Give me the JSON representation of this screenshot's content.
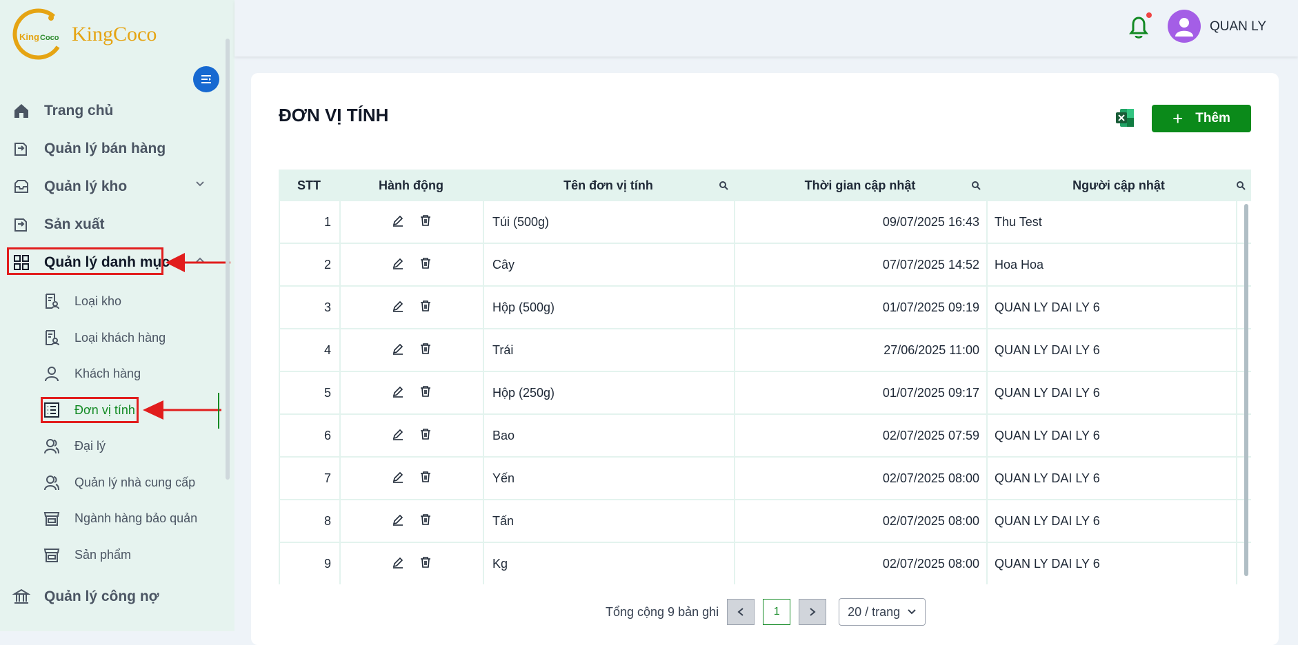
{
  "brand": {
    "name": "KingCoco",
    "logo_text": "KingCoco"
  },
  "header": {
    "username": "QUAN LY"
  },
  "sidebar": {
    "items": [
      {
        "label": "Trang chủ",
        "icon": "home-icon"
      },
      {
        "label": "Quản lý bán hàng",
        "icon": "sales-icon"
      },
      {
        "label": "Quản lý kho",
        "icon": "inventory-icon"
      },
      {
        "label": "Sản xuất",
        "icon": "production-icon"
      },
      {
        "label": "Quản lý danh mục",
        "icon": "grid-icon"
      },
      {
        "label": "Quản lý công nợ",
        "icon": "bank-icon"
      }
    ],
    "sub_items": [
      {
        "label": "Loại kho",
        "icon": "doc-user-icon"
      },
      {
        "label": "Loại khách hàng",
        "icon": "doc-user-icon"
      },
      {
        "label": "Khách hàng",
        "icon": "user-icon"
      },
      {
        "label": "Đơn vị tính",
        "icon": "list-icon"
      },
      {
        "label": "Đại lý",
        "icon": "users-icon"
      },
      {
        "label": "Quản lý nhà cung cấp",
        "icon": "users-icon"
      },
      {
        "label": "Ngành hàng bảo quản",
        "icon": "store-icon"
      },
      {
        "label": "Sản phẩm",
        "icon": "store-icon"
      }
    ]
  },
  "page": {
    "title": "ĐƠN VỊ TÍNH",
    "add_label": "Thêm"
  },
  "table": {
    "columns": [
      "STT",
      "Hành động",
      "Tên đơn vị tính",
      "Thời gian cập nhật",
      "Người cập nhật"
    ],
    "rows": [
      {
        "stt": "1",
        "name": "Túi (500g)",
        "time": "09/07/2025 16:43",
        "user": "Thu Test"
      },
      {
        "stt": "2",
        "name": "Cây",
        "time": "07/07/2025 14:52",
        "user": "Hoa Hoa"
      },
      {
        "stt": "3",
        "name": "Hộp (500g)",
        "time": "01/07/2025 09:19",
        "user": "QUAN LY DAI LY 6"
      },
      {
        "stt": "4",
        "name": "Trái",
        "time": "27/06/2025 11:00",
        "user": "QUAN LY DAI LY 6"
      },
      {
        "stt": "5",
        "name": "Hộp (250g)",
        "time": "01/07/2025 09:17",
        "user": "QUAN LY DAI LY 6"
      },
      {
        "stt": "6",
        "name": "Bao",
        "time": "02/07/2025 07:59",
        "user": "QUAN LY DAI LY 6"
      },
      {
        "stt": "7",
        "name": "Yến",
        "time": "02/07/2025 08:00",
        "user": "QUAN LY DAI LY 6"
      },
      {
        "stt": "8",
        "name": "Tấn",
        "time": "02/07/2025 08:00",
        "user": "QUAN LY DAI LY 6"
      },
      {
        "stt": "9",
        "name": "Kg",
        "time": "02/07/2025 08:00",
        "user": "QUAN LY DAI LY 6"
      }
    ]
  },
  "pagination": {
    "total_text": "Tổng cộng 9 bản ghi",
    "current_page": "1",
    "page_size": "20 / trang",
    "prev": "<",
    "next": ">"
  },
  "colors": {
    "accent": "#0b8a1a",
    "annotation": "#e11d1d",
    "sidebar_bg": "#e6f3ef"
  }
}
